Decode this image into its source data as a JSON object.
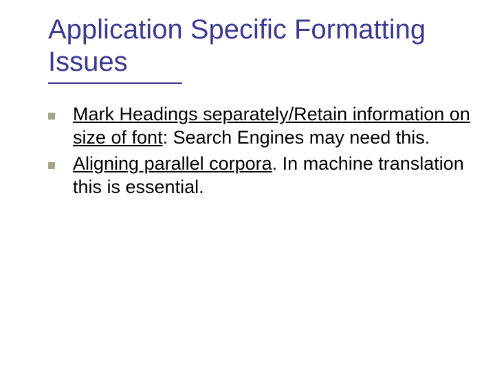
{
  "title": "Application Specific Formatting Issues",
  "bullets": [
    {
      "underlined": "Mark Headings separately/Retain information on size of font",
      "rest": ": Search Engines may need this."
    },
    {
      "underlined": "Aligning parallel corpora",
      "rest": ". In machine translation this is essential."
    }
  ]
}
